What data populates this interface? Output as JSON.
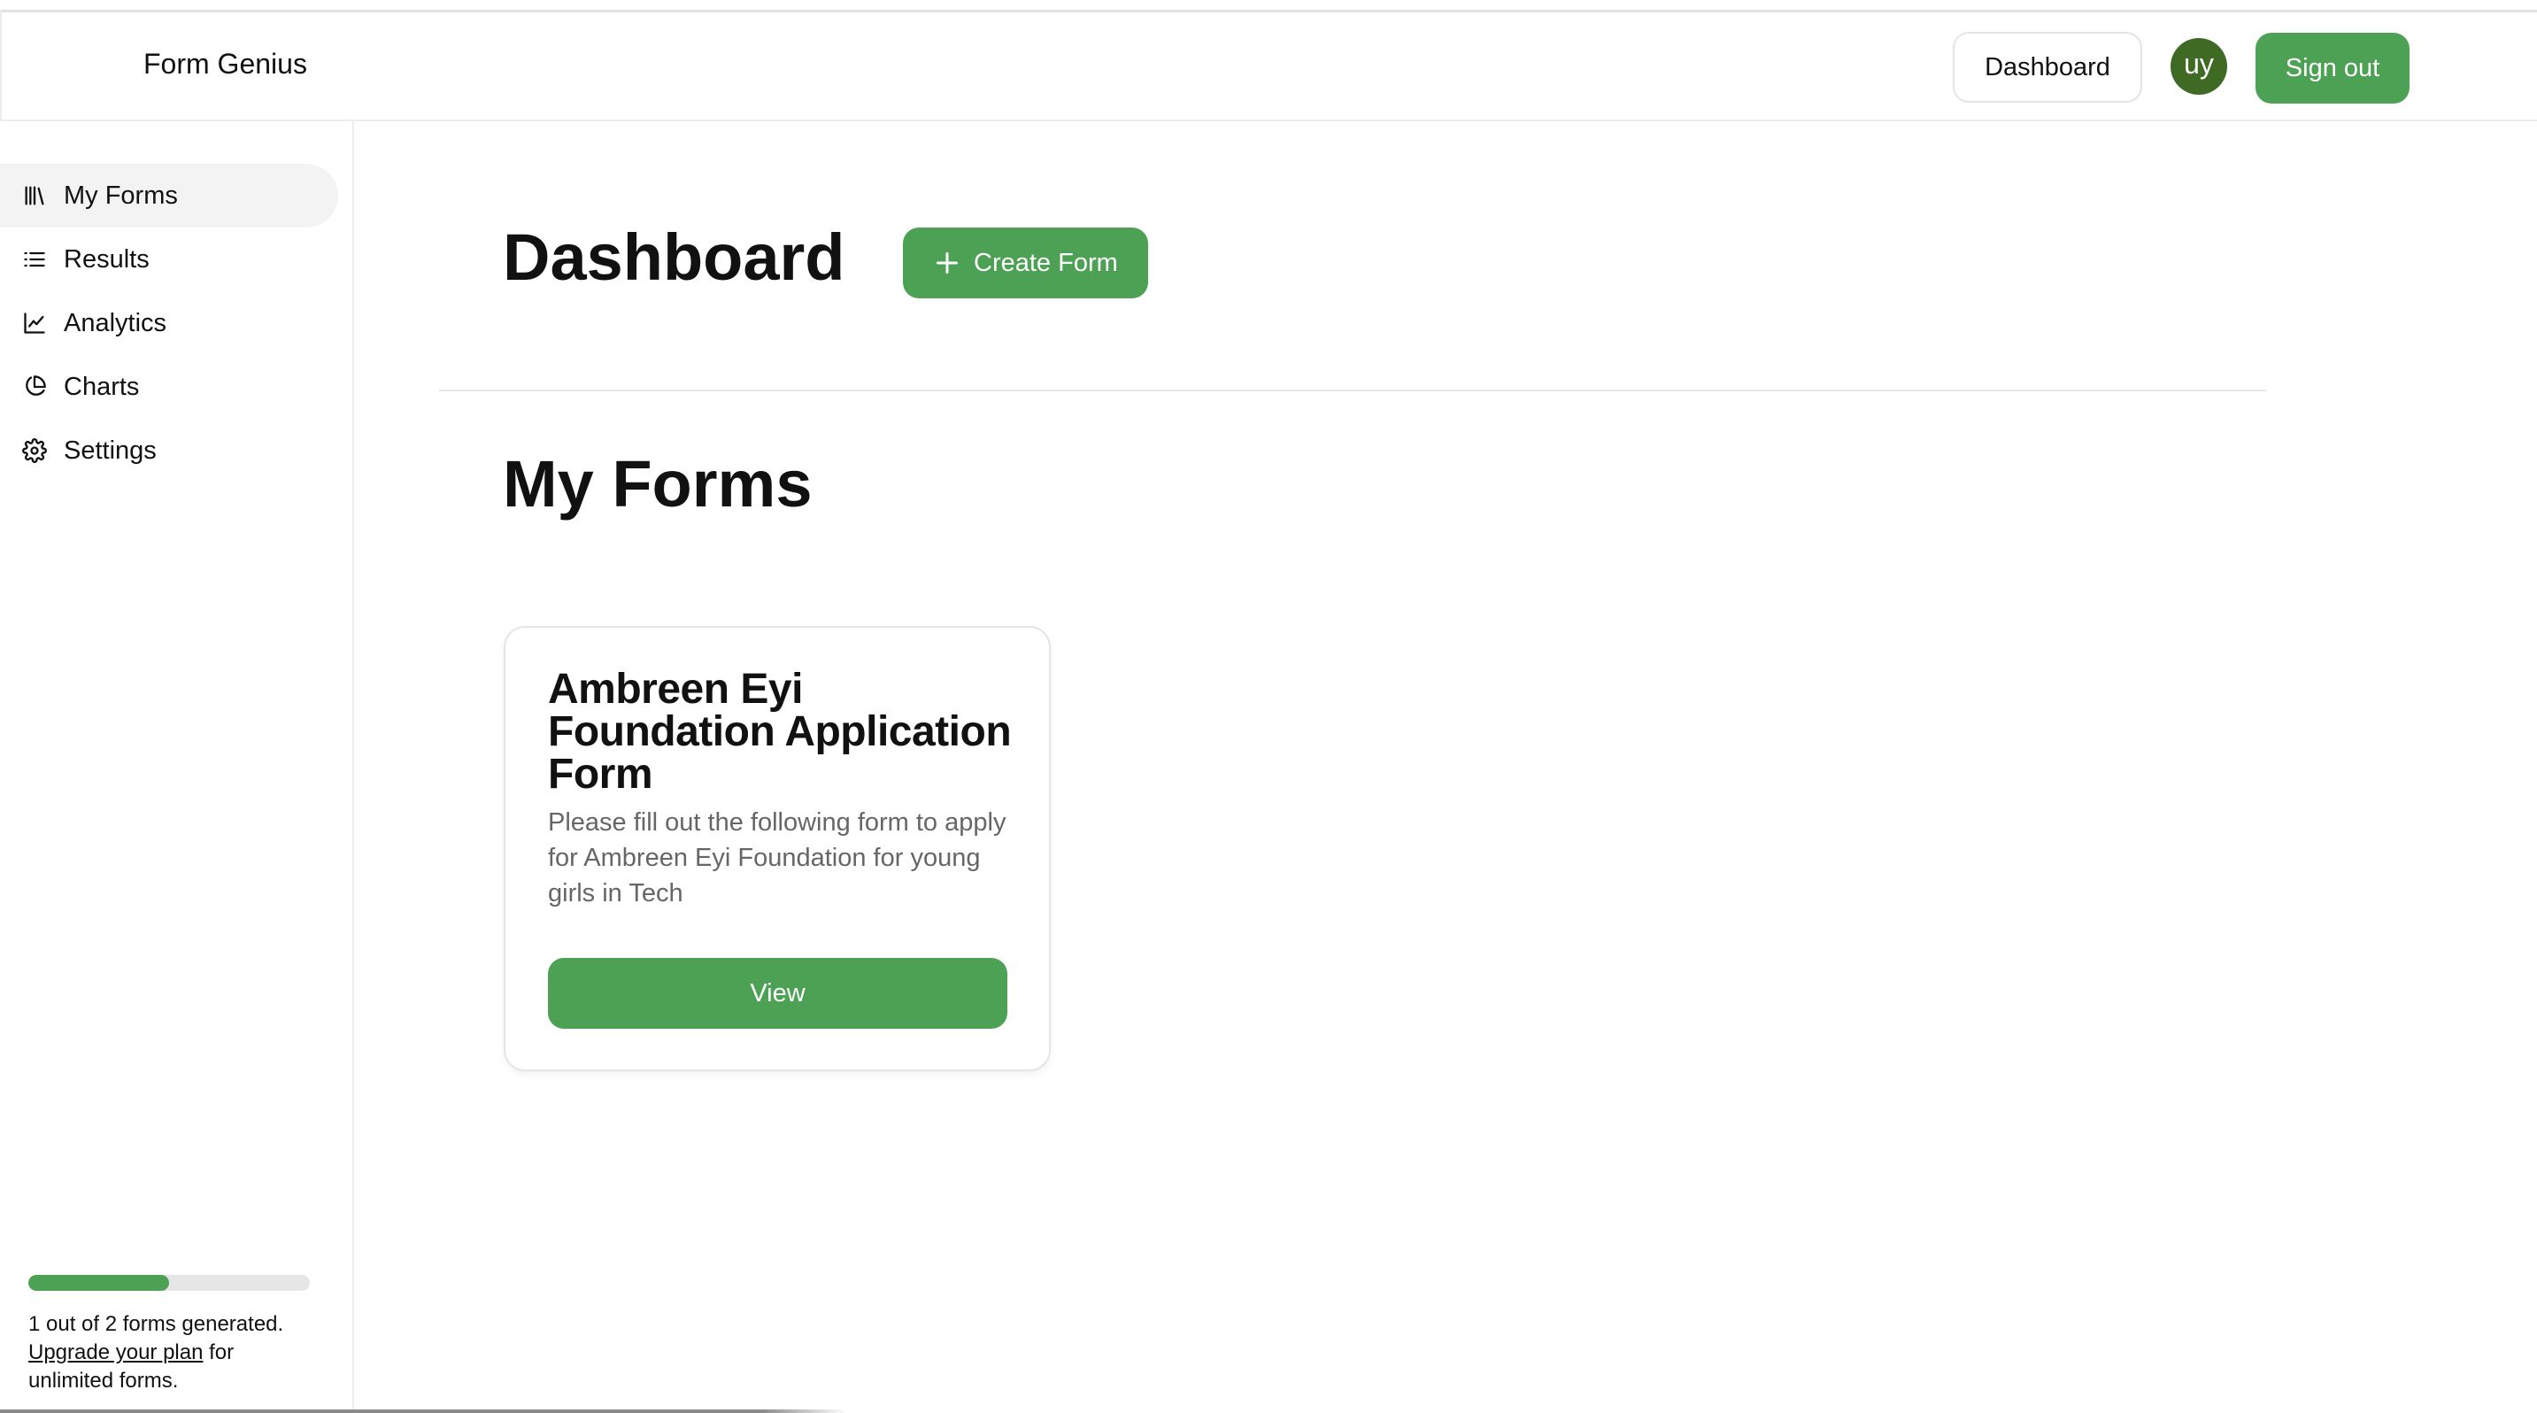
{
  "header": {
    "app_title": "Form Genius",
    "dashboard_label": "Dashboard",
    "avatar_initials": "uy",
    "signout_label": "Sign out"
  },
  "sidebar": {
    "items": [
      {
        "label": "My Forms",
        "icon": "library-icon",
        "active": true
      },
      {
        "label": "Results",
        "icon": "list-icon",
        "active": false
      },
      {
        "label": "Analytics",
        "icon": "line-chart-icon",
        "active": false
      },
      {
        "label": "Charts",
        "icon": "pie-chart-icon",
        "active": false
      },
      {
        "label": "Settings",
        "icon": "gear-icon",
        "active": false
      }
    ],
    "usage": {
      "progress_fraction": 0.5,
      "text_prefix": "1 out of 2 forms generated.",
      "upgrade_link": "Upgrade your plan",
      "text_suffix_1": "for",
      "text_suffix_2": "unlimited forms."
    }
  },
  "main": {
    "page_title": "Dashboard",
    "create_button_label": "Create Form",
    "section_title": "My Forms",
    "forms": [
      {
        "title": "Ambreen Eyi Foundation Application Form",
        "description": "Please fill out the following form to apply for Ambreen Eyi Foundation for young girls in Tech",
        "view_label": "View"
      }
    ]
  },
  "colors": {
    "accent": "#4ca154",
    "avatar_bg": "#3f6a24",
    "active_nav_bg": "#f3f3f3"
  }
}
